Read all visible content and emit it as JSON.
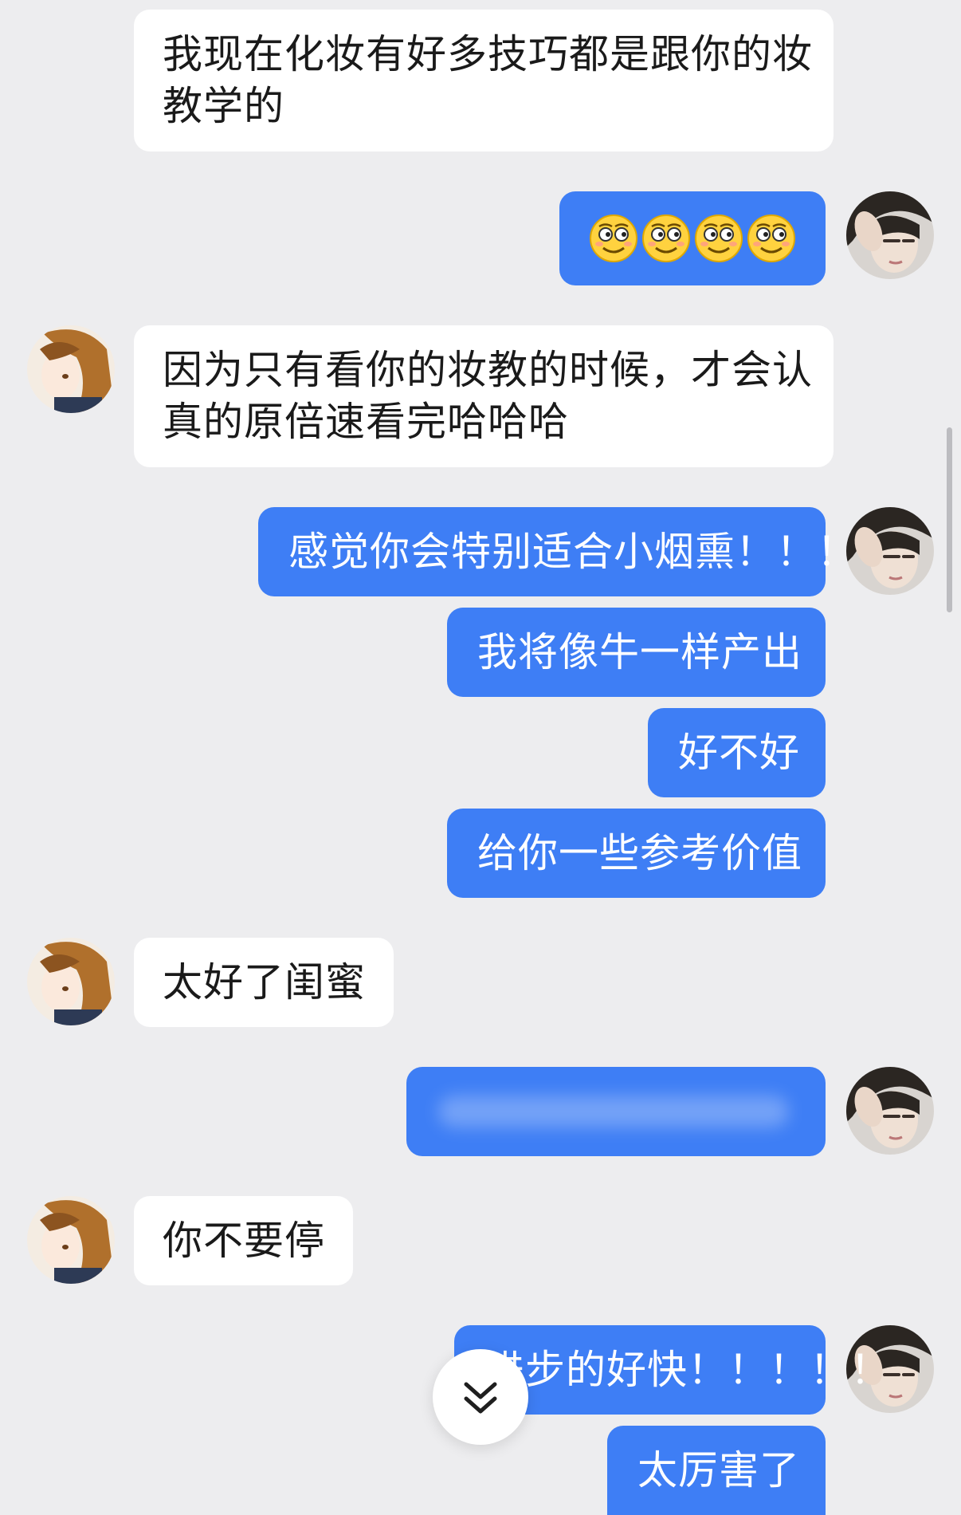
{
  "messages": [
    {
      "side": "incoming",
      "lines": [
        "我现在化妆有好多技巧都是跟你的妆",
        "教学的"
      ]
    },
    {
      "side": "outgoing",
      "emoji": [
        "smirk-emoji",
        "smirk-emoji",
        "smirk-emoji",
        "smirk-emoji"
      ]
    },
    {
      "side": "incoming",
      "lines": [
        "因为只有看你的妆教的时候，才会认",
        "真的原倍速看完哈哈哈"
      ]
    },
    {
      "side": "outgoing",
      "text": "感觉你会特别适合小烟熏！！！"
    },
    {
      "side": "outgoing",
      "text": "我将像牛一样产出"
    },
    {
      "side": "outgoing",
      "text": "好不好"
    },
    {
      "side": "outgoing",
      "text": "给你一些参考价值"
    },
    {
      "side": "incoming",
      "text": "太好了闺蜜"
    },
    {
      "side": "outgoing",
      "blurred": true
    },
    {
      "side": "incoming",
      "text": "你不要停"
    },
    {
      "side": "outgoing",
      "text": "进步的好快！！！！！"
    },
    {
      "side": "outgoing",
      "text": "太厉害了"
    }
  ],
  "colors": {
    "background": "#ededef",
    "incoming_bubble": "#ffffff",
    "outgoing_bubble": "#3e7ef5",
    "incoming_text": "#1a1a1a",
    "outgoing_text": "#ffffff"
  },
  "icons": {
    "scroll_down": "double-chevron-down-icon",
    "emoji": "smirk-emoji"
  }
}
